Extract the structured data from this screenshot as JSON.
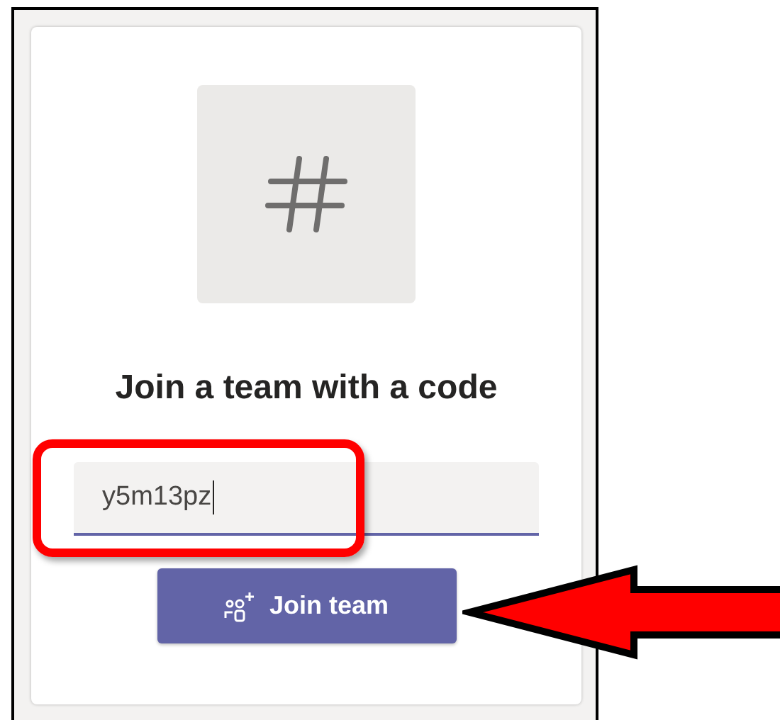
{
  "title": "Join a team with a code",
  "code_field": {
    "value": "y5m13pz",
    "focused": true
  },
  "join_button": {
    "label": "Join team"
  }
}
